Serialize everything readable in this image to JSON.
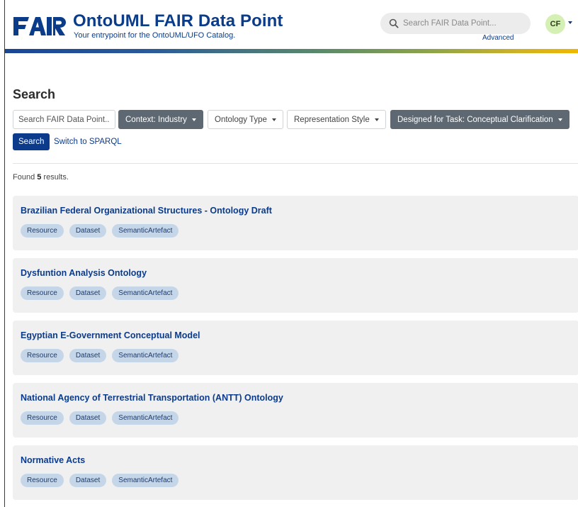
{
  "header": {
    "logo_text": "FAIR",
    "title": "OntoUML FAIR Data Point",
    "subtitle": "Your entrypoint for the OntoUML/UFO Catalog.",
    "search_placeholder": "Search FAIR Data Point...",
    "advanced_label": "Advanced",
    "avatar_initials": "CF",
    "search_icon": "search-icon"
  },
  "colors": {
    "brand_blue": "#0b3b8a",
    "dark_filter": "#5e6872",
    "tag_bg": "#c5d6e9",
    "card_bg": "#f0f0f0",
    "avatar_bg": "#d4f0b5"
  },
  "search": {
    "heading": "Search",
    "input_placeholder": "Search FAIR Data Point...",
    "filters": [
      {
        "label": "Context: Industry",
        "active": true
      },
      {
        "label": "Ontology Type",
        "active": false
      },
      {
        "label": "Representation Style",
        "active": false
      },
      {
        "label": "Designed for Task: Conceptual Clarification",
        "active": true
      }
    ],
    "search_button": "Search",
    "sparql_link": "Switch to SPARQL"
  },
  "results": {
    "found_prefix": "Found ",
    "count": "5",
    "found_suffix": " results.",
    "items": [
      {
        "title": "Brazilian Federal Organizational Structures - Ontology Draft",
        "tags": [
          "Resource",
          "Dataset",
          "SemanticArtefact"
        ]
      },
      {
        "title": "Dysfuntion Analysis Ontology",
        "tags": [
          "Resource",
          "Dataset",
          "SemanticArtefact"
        ]
      },
      {
        "title": "Egyptian E-Government Conceptual Model",
        "tags": [
          "Resource",
          "Dataset",
          "SemanticArtefact"
        ]
      },
      {
        "title": "National Agency of Terrestrial Transportation (ANTT) Ontology",
        "tags": [
          "Resource",
          "Dataset",
          "SemanticArtefact"
        ]
      },
      {
        "title": "Normative Acts",
        "tags": [
          "Resource",
          "Dataset",
          "SemanticArtefact"
        ]
      }
    ]
  }
}
